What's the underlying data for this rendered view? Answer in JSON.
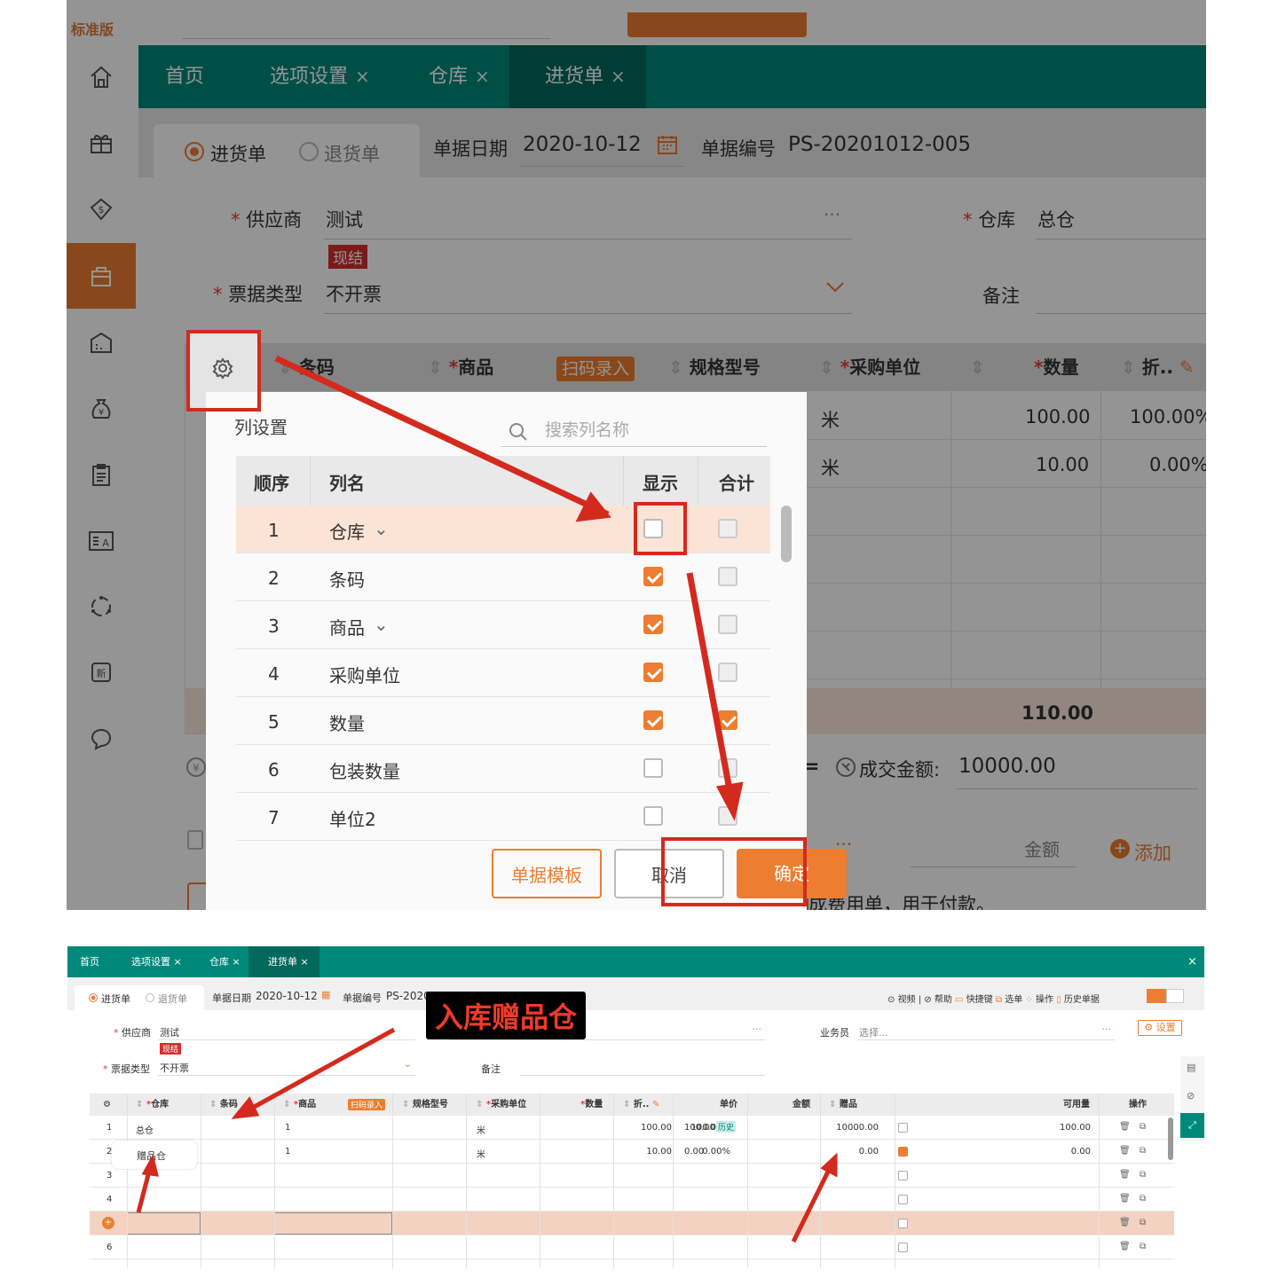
{
  "top": {
    "edition": "标准版",
    "tabs": [
      {
        "label": "首页",
        "closable": false
      },
      {
        "label": "选项设置",
        "closable": true
      },
      {
        "label": "仓库",
        "closable": true
      },
      {
        "label": "进货单",
        "closable": true
      }
    ],
    "close_mark": "×",
    "radio_purchase": "进货单",
    "radio_return": "退货单",
    "date_label": "单据日期",
    "date_value": "2020-10-12",
    "no_label": "单据编号",
    "no_value": "PS-20201012-005",
    "supplier_label": "供应商",
    "supplier_value": "测试",
    "settle_badge": "现结",
    "warehouse_label": "仓库",
    "warehouse_value": "总仓",
    "invoice_label": "票据类型",
    "invoice_value": "不开票",
    "remark_label": "备注",
    "ellipsis": "···",
    "grid_headers": {
      "barcode": "条码",
      "product": "商品",
      "scan": "扫码录入",
      "spec": "规格型号",
      "unit": "采购单位",
      "qty": "数量",
      "discount": "折.."
    },
    "grid_rows": [
      {
        "unit": "米",
        "qty": "100.00",
        "discount": "100.00%"
      },
      {
        "unit": "米",
        "qty": "10.00",
        "discount": "0.00%"
      }
    ],
    "total_qty": "110.00",
    "deal_label": "成交金额:",
    "deal_value": "10000.00",
    "amount_placeholder": "金额",
    "add_label": "添加",
    "footer_note": "成费用单，用于付款。",
    "dialog": {
      "title": "列设置",
      "search_placeholder": "搜索列名称",
      "headers": {
        "order": "顺序",
        "name": "列名",
        "show": "显示",
        "sum": "合计"
      },
      "rows": [
        {
          "order": "1",
          "name": "仓库",
          "dropdown": true,
          "show": false,
          "sum": false
        },
        {
          "order": "2",
          "name": "条码",
          "dropdown": false,
          "show": true,
          "sum": false
        },
        {
          "order": "3",
          "name": "商品",
          "dropdown": true,
          "show": true,
          "sum": false
        },
        {
          "order": "4",
          "name": "采购单位",
          "dropdown": false,
          "show": true,
          "sum": false
        },
        {
          "order": "5",
          "name": "数量",
          "dropdown": false,
          "show": true,
          "sum": true
        },
        {
          "order": "6",
          "name": "包装数量",
          "dropdown": false,
          "show": false,
          "sum": false
        },
        {
          "order": "7",
          "name": "单位2",
          "dropdown": false,
          "show": false,
          "sum": false
        }
      ],
      "btn_template": "单据模板",
      "btn_cancel": "取消",
      "btn_ok": "确定"
    }
  },
  "bottom": {
    "tabs": [
      {
        "label": "首页",
        "closable": false
      },
      {
        "label": "选项设置",
        "closable": true
      },
      {
        "label": "仓库",
        "closable": true
      },
      {
        "label": "进货单",
        "closable": true
      }
    ],
    "radio_purchase": "进货单",
    "radio_return": "退货单",
    "date_label": "单据日期",
    "date_value": "2020-10-12",
    "no_label": "单据编号",
    "no_value": "PS-2020",
    "toolbar": [
      "视频",
      "帮助",
      "快捷键",
      "选单",
      "操作",
      "历史单据"
    ],
    "supplier_label": "供应商",
    "supplier_value": "测试",
    "settle_badge": "现结",
    "salesman_label": "业务员",
    "salesman_placeholder": "选择...",
    "settings_label": "设置",
    "invoice_label": "票据类型",
    "invoice_value": "不开票",
    "remark_label": "备注",
    "callout": "入库赠品仓",
    "headers": {
      "warehouse": "仓库",
      "barcode": "条码",
      "product": "商品",
      "scan": "扫码录入",
      "spec": "规格型号",
      "unit": "采购单位",
      "qty": "数量",
      "discount": "折..",
      "price": "单价",
      "amount": "金额",
      "gift": "赠品",
      "available": "可用量",
      "ops": "操作"
    },
    "history_badge": "历史",
    "rows": [
      {
        "no": "1",
        "warehouse": "总仓",
        "product": "1",
        "unit": "米",
        "qty": "100.00",
        "discount": "100.00%",
        "price": "100.00",
        "amount": "10000.00",
        "gift": false,
        "available": "100.00"
      },
      {
        "no": "2",
        "warehouse": "赠品仓",
        "product": "1",
        "unit": "米",
        "qty": "10.00",
        "discount": "0.00%",
        "price": "0.00",
        "amount": "0.00",
        "gift": true,
        "available": "0.00"
      },
      {
        "no": "3"
      },
      {
        "no": "4"
      },
      {
        "no": "+"
      },
      {
        "no": "6"
      }
    ]
  },
  "colors": {
    "teal": "#00897b",
    "teal_dark": "#00695c",
    "orange": "#ed7d31",
    "arrow_red": "#d42a1e",
    "highlight_row": "#fbe3d6"
  }
}
